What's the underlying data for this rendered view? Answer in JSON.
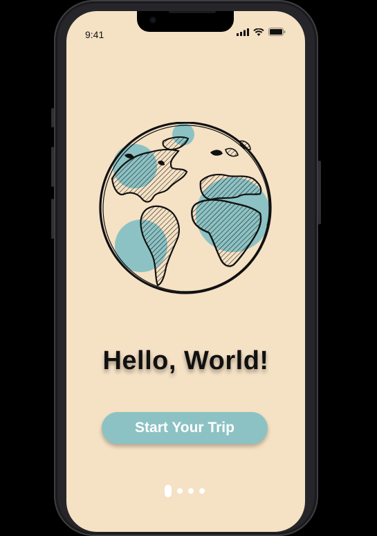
{
  "status_bar": {
    "time": "9:41"
  },
  "onboarding": {
    "title": "Hello, World!",
    "cta_label": "Start Your Trip",
    "illustration": "globe-sketch",
    "pagination": {
      "total": 4,
      "active_index": 0
    }
  },
  "colors": {
    "background": "#f5e1c4",
    "accent": "#8cc2c4",
    "text": "#111111"
  },
  "icons": [
    "signal-icon",
    "wifi-icon",
    "battery-icon"
  ]
}
